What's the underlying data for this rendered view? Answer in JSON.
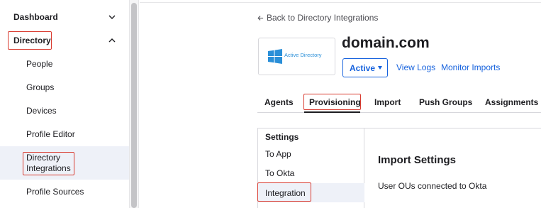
{
  "sidebar": {
    "groups": [
      {
        "label": "Dashboard",
        "expanded": false
      },
      {
        "label": "Directory",
        "expanded": true
      }
    ],
    "items": [
      {
        "label": "People"
      },
      {
        "label": "Groups"
      },
      {
        "label": "Devices"
      },
      {
        "label": "Profile Editor"
      },
      {
        "label_line1": "Directory",
        "label_line2": "Integrations",
        "selected": true
      },
      {
        "label": "Profile Sources"
      }
    ]
  },
  "header": {
    "back_link": "Back to Directory Integrations",
    "logo_text": "Active Directory",
    "app_name": "domain.com",
    "status": "Active",
    "links": [
      "View Logs",
      "Monitor Imports"
    ]
  },
  "tabs": [
    {
      "label": "Agents"
    },
    {
      "label": "Provisioning",
      "active": true
    },
    {
      "label": "Import"
    },
    {
      "label": "Push Groups"
    },
    {
      "label": "Assignments"
    }
  ],
  "settings_nav": {
    "heading": "Settings",
    "items": [
      {
        "label": "To App"
      },
      {
        "label": "To Okta"
      },
      {
        "label": "Integration",
        "selected": true
      }
    ]
  },
  "section": {
    "title": "Import Settings",
    "text": "User OUs connected to Okta"
  },
  "colors": {
    "link": "#1662dd",
    "highlight_box": "#d93b30",
    "selected_bg": "#eef1f8",
    "windows_logo": "#2a8fd8"
  },
  "icons": {
    "dashboard_chevron": "chevron-down-icon",
    "directory_chevron": "chevron-up-icon",
    "back_arrow": "arrow-left-icon",
    "status_caret": "caret-down-icon",
    "logo": "windows-logo-icon"
  }
}
